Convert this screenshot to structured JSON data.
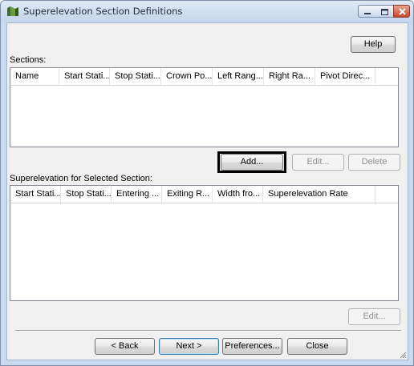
{
  "window": {
    "title": "Superelevation Section Definitions"
  },
  "buttons": {
    "help": "Help",
    "add": "Add...",
    "edit_sections": "Edit...",
    "delete": "Delete",
    "edit_superelevation": "Edit...",
    "back": "< Back",
    "next": "Next >",
    "preferences": "Preferences...",
    "close": "Close"
  },
  "sections": {
    "label": "Sections:",
    "columns": [
      "Name",
      "Start Stati...",
      "Stop Stati...",
      "Crown Po...",
      "Left Rang...",
      "Right Ra...",
      "Pivot Direc..."
    ],
    "rows": []
  },
  "superelevation": {
    "label": "Superelevation for Selected Section:",
    "columns": [
      "Start Stati...",
      "Stop Stati...",
      "Entering ...",
      "Exiting R...",
      "Width fro...",
      "Superelevation Rate"
    ],
    "rows": []
  },
  "colors": {
    "title_bar": "#c9daee",
    "close_button": "#c7452a",
    "highlight_border": "#000000"
  }
}
